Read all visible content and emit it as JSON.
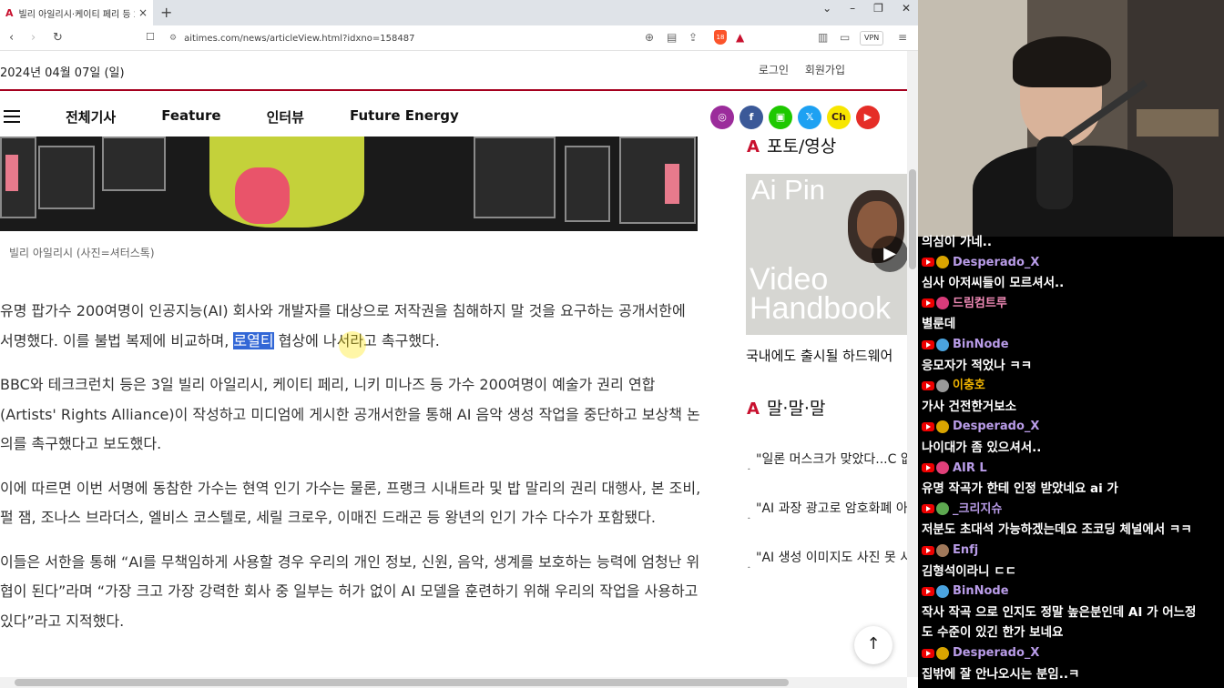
{
  "browser": {
    "tab_title": "빌리 아일리시·케이티 페리 등 2",
    "tab_close": "×",
    "new_tab": "+",
    "url": "aitimes.com/news/articleView.html?idxno=158487",
    "vpn": "VPN",
    "brave_count": "18",
    "window_controls": {
      "expand": "⌄",
      "minimize": "–",
      "restore": "❐",
      "close": "✕"
    }
  },
  "page": {
    "date": "2024년 04월 07일 (일)",
    "top_links": {
      "login": "로그인",
      "signup": "회원가입"
    },
    "nav": [
      "전체기사",
      "Feature",
      "인터뷰",
      "Future Energy"
    ],
    "social": [
      {
        "name": "instagram",
        "glyph": "◎",
        "color": "#9b2c9b"
      },
      {
        "name": "facebook",
        "glyph": "f",
        "color": "#3b5998"
      },
      {
        "name": "naver-tv",
        "glyph": "▣",
        "color": "#1ec800"
      },
      {
        "name": "x",
        "glyph": "𝕏",
        "color": "#1da1f2"
      },
      {
        "name": "kakao-channel",
        "glyph": "Ch",
        "color": "#f7e600"
      },
      {
        "name": "youtube",
        "glyph": "▶",
        "color": "#e52d27"
      }
    ],
    "photo_caption": "빌리 아일리시 (사진=셔터스톡)",
    "article": {
      "p1_before": "유명 팝가수 200여명이 인공지능(AI) 회사와 개발자를 대상으로 저작권을 침해하지 말 것을 요구하는 공개서한에 서명했다. 이를 불법 복제에 비교하며, ",
      "p1_highlight": "로열티",
      "p1_after": " 협상에 나서라고 촉구했다.",
      "p2": "BBC와 테크크런치 등은 3일 빌리 아일리시, 케이티 페리, 니키 미나즈 등 가수 200여명이 예술가 권리 연합(Artists' Rights Alliance)이 작성하고 미디엄에 게시한 공개서한을 통해 AI 음악 생성 작업을 중단하고 보상책 논의를 촉구했다고 보도했다.",
      "p3": "이에 따르면 이번 서명에 동참한 가수는 현역 인기 가수는 물론, 프랭크 시내트라 및 밥 말리의 권리 대행사, 본 조비, 펄 잼, 조나스 브라더스, 엘비스 코스텔로, 세릴 크로우, 이매진 드래곤 등 왕년의 인기 가수 다수가 포함됐다.",
      "p4": "이들은 서한을 통해 “AI를 무책임하게 사용할 경우 우리의 개인 정보, 신원, 음악, 생계를 보호하는 능력에 엄청난 위협이 된다”라며 “가장 크고 가장 강력한 회사 중 일부는 허가 없이 AI 모델을 훈련하기 위해 우리의 작업을 사용하고 있다”라고 지적했다."
    },
    "sidebar": {
      "photo_video_title": "포토/영상",
      "video_overlay_top": "Ai Pin",
      "video_overlay_bottom": "Video Handbook",
      "video_caption": "국내에도 출시될 하드웨어",
      "mal_title": "말·말·말",
      "quotes": [
        "\"일론 머스크가 맞았다...C 없는 일이었다\"",
        "\"AI 과장 광고로 암호화폐 아...과학적 진보 방해하는",
        "\"AI 생성 이미지도 사진 못 사실, 사진 자체도 현실은 ("
      ]
    },
    "back_to_top": "↑"
  },
  "chat": {
    "lines": [
      {
        "type": "msg",
        "text": "의심이 가네.."
      },
      {
        "type": "user",
        "name": "Desperado_X",
        "badge": "#d9a400",
        "color": "#b99ce8"
      },
      {
        "type": "msg",
        "text": "심사 아저씨들이 모르셔서.."
      },
      {
        "type": "user",
        "name": "드림컴트루",
        "badge": "#d93b7a",
        "color": "#f08ab6"
      },
      {
        "type": "msg",
        "text": "별룬데"
      },
      {
        "type": "user",
        "name": "BinNode",
        "badge": "#4aa3df",
        "color": "#b99ce8"
      },
      {
        "type": "msg",
        "text": "응모자가 적었나 ㅋㅋ"
      },
      {
        "type": "user",
        "name": "이충호",
        "badge": "#999",
        "color": "#f0b400"
      },
      {
        "type": "msg",
        "text": "가사 건전한거보소"
      },
      {
        "type": "user",
        "name": "Desperado_X",
        "badge": "#d9a400",
        "color": "#b99ce8"
      },
      {
        "type": "msg",
        "text": "나이대가 좀 있으셔서.."
      },
      {
        "type": "user",
        "name": "AIR L",
        "badge": "#e0407a",
        "color": "#b99ce8"
      },
      {
        "type": "msg",
        "text": "유명 작곡가 한테 인정 받았네요 ai 가"
      },
      {
        "type": "user",
        "name": "_크리지슈",
        "badge": "#5da850",
        "color": "#b99ce8"
      },
      {
        "type": "msg",
        "text": "저분도 초대석 가능하겠는데요 조코딩 체널에서 ㅋㅋ"
      },
      {
        "type": "user",
        "name": "Enfj",
        "badge": "#a0785a",
        "color": "#b99ce8"
      },
      {
        "type": "msg",
        "text": "김형석이라니 ㄷㄷ"
      },
      {
        "type": "user",
        "name": "BinNode",
        "badge": "#4aa3df",
        "color": "#b99ce8"
      },
      {
        "type": "msg",
        "text": "작사 작곡 으로 인지도 정말 높은분인데 AI 가 어느정"
      },
      {
        "type": "msg",
        "text": "도 수준이 있긴 한가 보네요"
      },
      {
        "type": "user",
        "name": "Desperado_X",
        "badge": "#d9a400",
        "color": "#b99ce8"
      },
      {
        "type": "msg",
        "text": "집밖에 잘 안나오시는 분임..ㅋ"
      }
    ]
  }
}
